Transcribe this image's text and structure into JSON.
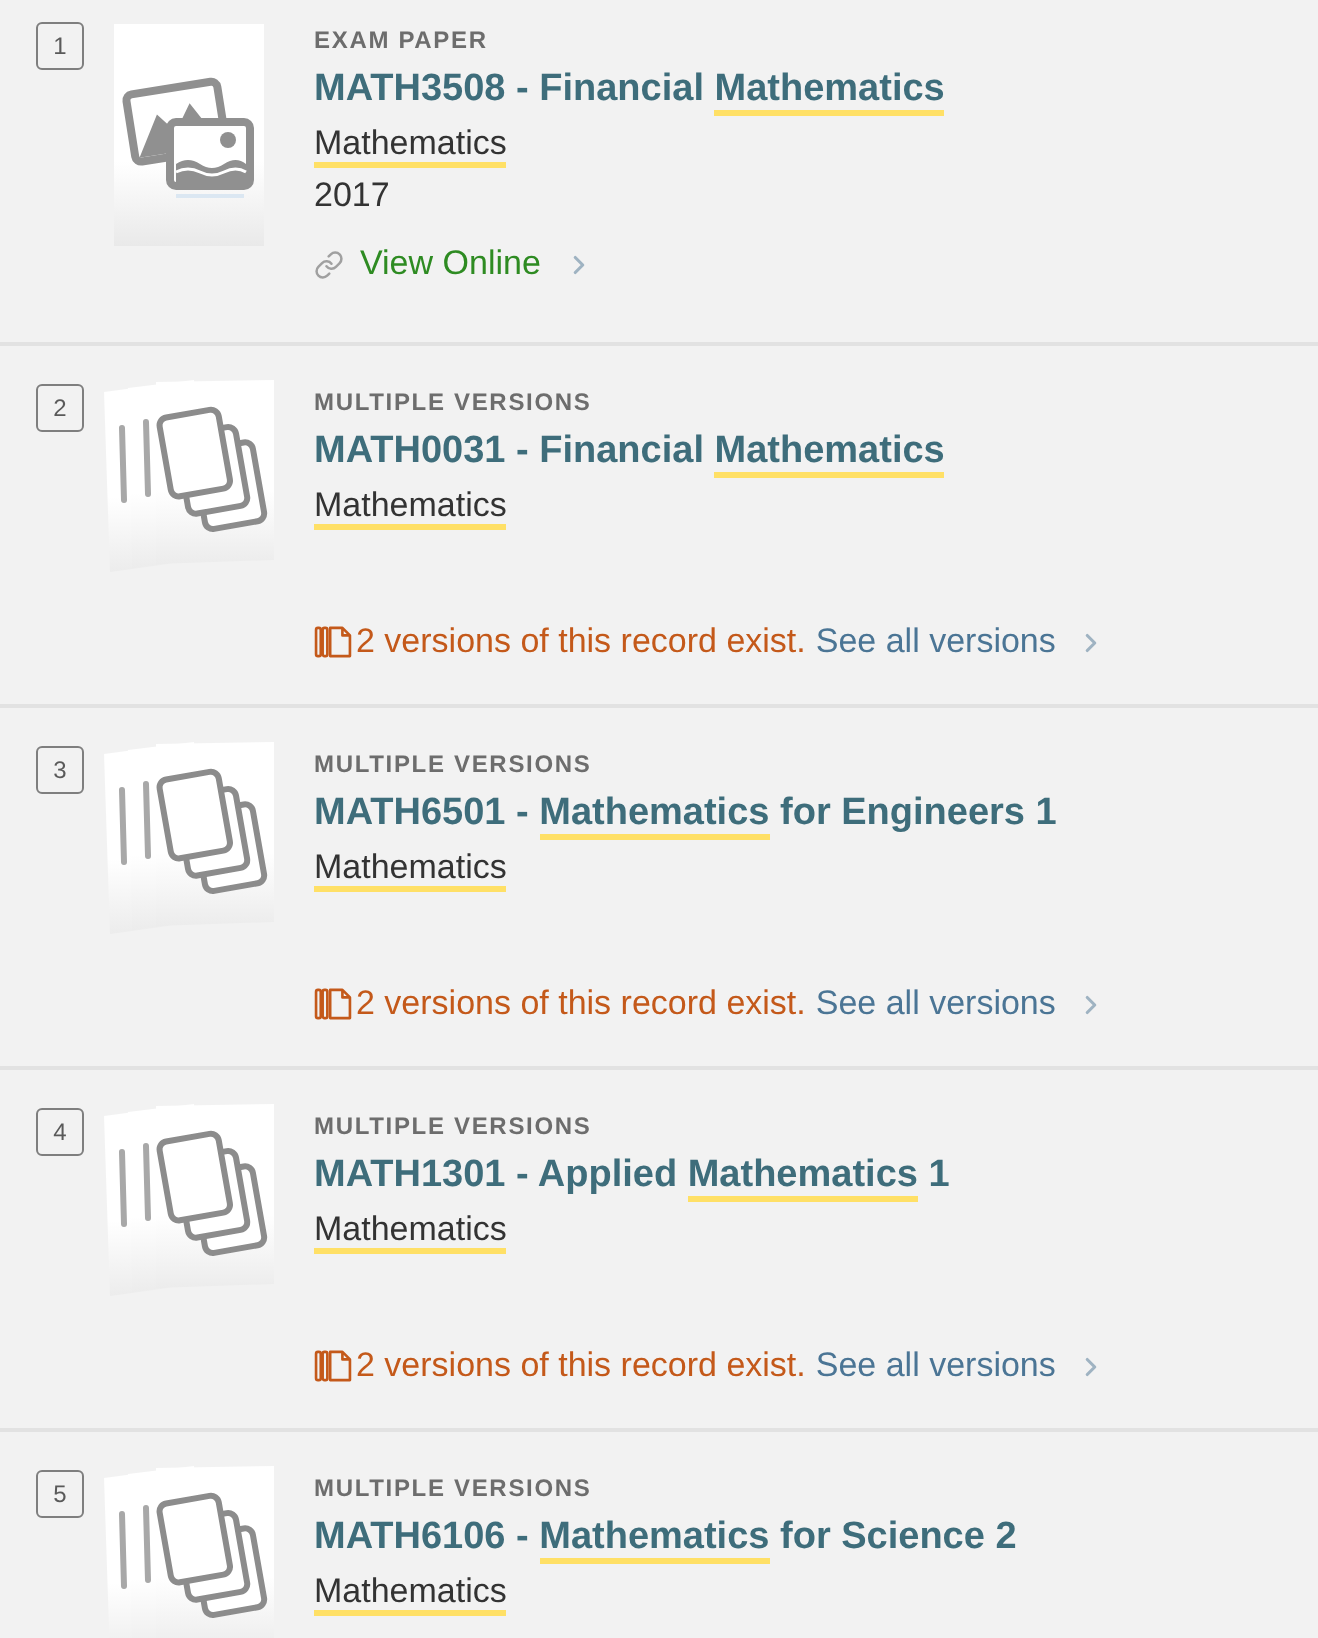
{
  "results": [
    {
      "number": "1",
      "kind": "image",
      "type_label": "EXAM PAPER",
      "title": [
        {
          "text": "MATH3508 - Financial ",
          "highlighted": false
        },
        {
          "text": "Mathematics",
          "highlighted": true
        }
      ],
      "subject": {
        "text": "Mathematics",
        "highlighted": true
      },
      "year": "2017",
      "link": {
        "label": "View Online"
      }
    },
    {
      "number": "2",
      "kind": "versions",
      "type_label": "MULTIPLE VERSIONS",
      "title": [
        {
          "text": "MATH0031 - Financial ",
          "highlighted": false
        },
        {
          "text": "Mathematics",
          "highlighted": true
        }
      ],
      "subject": {
        "text": "Mathematics",
        "highlighted": true
      },
      "versions": {
        "note": "2 versions of this record exist.",
        "link": "See all versions"
      }
    },
    {
      "number": "3",
      "kind": "versions",
      "type_label": "MULTIPLE VERSIONS",
      "title": [
        {
          "text": "MATH6501 - ",
          "highlighted": false
        },
        {
          "text": "Mathematics",
          "highlighted": true
        },
        {
          "text": " for Engineers 1",
          "highlighted": false
        }
      ],
      "subject": {
        "text": "Mathematics",
        "highlighted": true
      },
      "versions": {
        "note": "2 versions of this record exist.",
        "link": "See all versions"
      }
    },
    {
      "number": "4",
      "kind": "versions",
      "type_label": "MULTIPLE VERSIONS",
      "title": [
        {
          "text": "MATH1301 - Applied ",
          "highlighted": false
        },
        {
          "text": "Mathematics",
          "highlighted": true
        },
        {
          "text": " 1",
          "highlighted": false
        }
      ],
      "subject": {
        "text": "Mathematics",
        "highlighted": true
      },
      "versions": {
        "note": "2 versions of this record exist.",
        "link": "See all versions"
      }
    },
    {
      "number": "5",
      "kind": "versions",
      "type_label": "MULTIPLE VERSIONS",
      "title": [
        {
          "text": "MATH6106 - ",
          "highlighted": false
        },
        {
          "text": "Mathematics",
          "highlighted": true
        },
        {
          "text": " for Science 2",
          "highlighted": false
        }
      ],
      "subject": {
        "text": "Mathematics",
        "highlighted": true
      }
    }
  ]
}
